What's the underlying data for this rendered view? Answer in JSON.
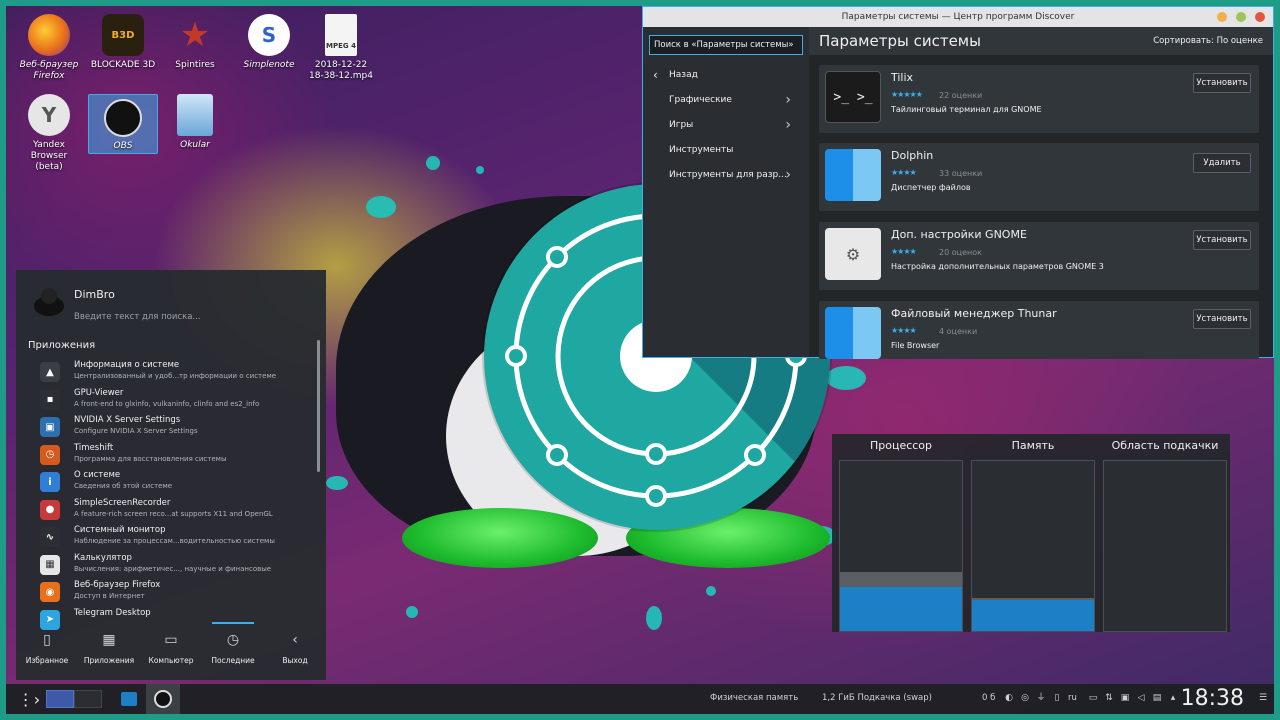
{
  "desktop_icons": [
    {
      "name": "firefox-desktop-icon",
      "label_line1": "Веб-браузер",
      "label_line2": "Firefox"
    },
    {
      "name": "blockade-desktop-icon",
      "label_line1": "BLOCKADE 3D",
      "label_line2": ""
    },
    {
      "name": "spintires-desktop-icon",
      "label_line1": "Spintires",
      "label_line2": ""
    },
    {
      "name": "simplenote-desktop-icon",
      "label_line1": "Simplenote",
      "label_line2": ""
    },
    {
      "name": "video-file-desktop-icon",
      "label_line1": "2018-12-22",
      "label_line2": "18-38-12.mp4",
      "badge": "MPEG 4"
    },
    {
      "name": "yandex-desktop-icon",
      "label_line1": "Yandex Browser",
      "label_line2": "(beta)"
    },
    {
      "name": "obs-desktop-icon",
      "label_line1": "OBS",
      "label_line2": ""
    },
    {
      "name": "okular-desktop-icon",
      "label_line1": "Okular",
      "label_line2": ""
    }
  ],
  "discover": {
    "window_title": "Параметры системы — Центр программ Discover",
    "search_placeholder": "Поиск в «Параметры системы»",
    "nav": [
      "Назад",
      "Графические",
      "Игры",
      "Инструменты",
      "Инструменты для разр..."
    ],
    "header_title": "Параметры системы",
    "sort_label": "Сортировать: По оценке",
    "apps": [
      {
        "name": "Tilix",
        "stars": "★★★★★",
        "rating": "22 оценки",
        "desc": "Тайлинговый терминал для GNOME",
        "action": "Установить"
      },
      {
        "name": "Dolphin",
        "stars": "★★★★",
        "rating": "33 оценки",
        "desc": "Диспетчер файлов",
        "action": "Удалить"
      },
      {
        "name": "Доп. настройки GNOME",
        "stars": "★★★★",
        "rating": "20 оценок",
        "desc": "Настройка дополнительных параметров GNOME 3",
        "action": "Установить"
      },
      {
        "name": "Файловый менеджер Thunar",
        "stars": "★★★★",
        "rating": "4 оценки",
        "desc": "File Browser",
        "action": "Установить"
      }
    ]
  },
  "sysmon": {
    "columns": [
      "Процессор",
      "Память",
      "Область подкачки"
    ],
    "cpu_usage_fraction": 0.26,
    "memory_usage_fraction": 0.18,
    "swap_usage_fraction": 0.0
  },
  "launcher": {
    "user": "DimBro",
    "search_placeholder": "Введите текст для поиска...",
    "section": "Приложения",
    "entries": [
      {
        "name": "Информация о системе",
        "desc": "Централизованный и удоб...тр информации о системе",
        "icon_color": "#3a3f44",
        "icon": "▲"
      },
      {
        "name": "GPU-Viewer",
        "desc": "A front-end to glxinfo, vulkaninfo, clinfo and es2_info",
        "icon_color": "#2b2f33",
        "icon": "▪"
      },
      {
        "name": "NVIDIA X Server Settings",
        "desc": "Configure NVIDIA X Server Settings",
        "icon_color": "#2e6fb0",
        "icon": "▣"
      },
      {
        "name": "Timeshift",
        "desc": "Программа для восстановления системы",
        "icon_color": "#d65a1e",
        "icon": "◷"
      },
      {
        "name": "О системе",
        "desc": "Сведения об этой системе",
        "icon_color": "#2f7ed8",
        "icon": "i"
      },
      {
        "name": "SimpleScreenRecorder",
        "desc": "A feature-rich screen reco...at supports X11 and OpenGL",
        "icon_color": "#c73a3a",
        "icon": "●"
      },
      {
        "name": "Системный монитор",
        "desc": "Наблюдение за процессам...водительностью системы",
        "icon_color": "#2b2f33",
        "icon": "∿"
      },
      {
        "name": "Калькулятор",
        "desc": "Вычисления: арифметичес..., научные и финансовые",
        "icon_color": "#e6e6e6",
        "icon": "▦"
      },
      {
        "name": "Веб-браузер Firefox",
        "desc": "Доступ в Интернет",
        "icon_color": "#e8701a",
        "icon": "◉"
      },
      {
        "name": "Telegram Desktop",
        "desc": "",
        "icon_color": "#2ca5e0",
        "icon": "➤"
      }
    ],
    "tabs": [
      {
        "label": "Избранное",
        "icon": "bookmark-icon",
        "glyph": "▯"
      },
      {
        "label": "Приложения",
        "icon": "grid-icon",
        "glyph": "▦"
      },
      {
        "label": "Компьютер",
        "icon": "monitor-icon",
        "glyph": "▭"
      },
      {
        "label": "Последние",
        "icon": "clock-icon",
        "glyph": "◷"
      },
      {
        "label": "Выход",
        "icon": "exit-icon",
        "glyph": "‹"
      }
    ]
  },
  "taskbar": {
    "memory_label": "Физическая память",
    "swap_label": "1,2 ГиБ Подкачка (swap)",
    "zero_label": "0 б",
    "lang": "ru",
    "clock": "18:38"
  },
  "colors": {
    "accent": "#3daee9",
    "frame": "#1e9c88",
    "logo_teal": "#1fa7a1",
    "penguin_feet": "#1dbb2d"
  }
}
